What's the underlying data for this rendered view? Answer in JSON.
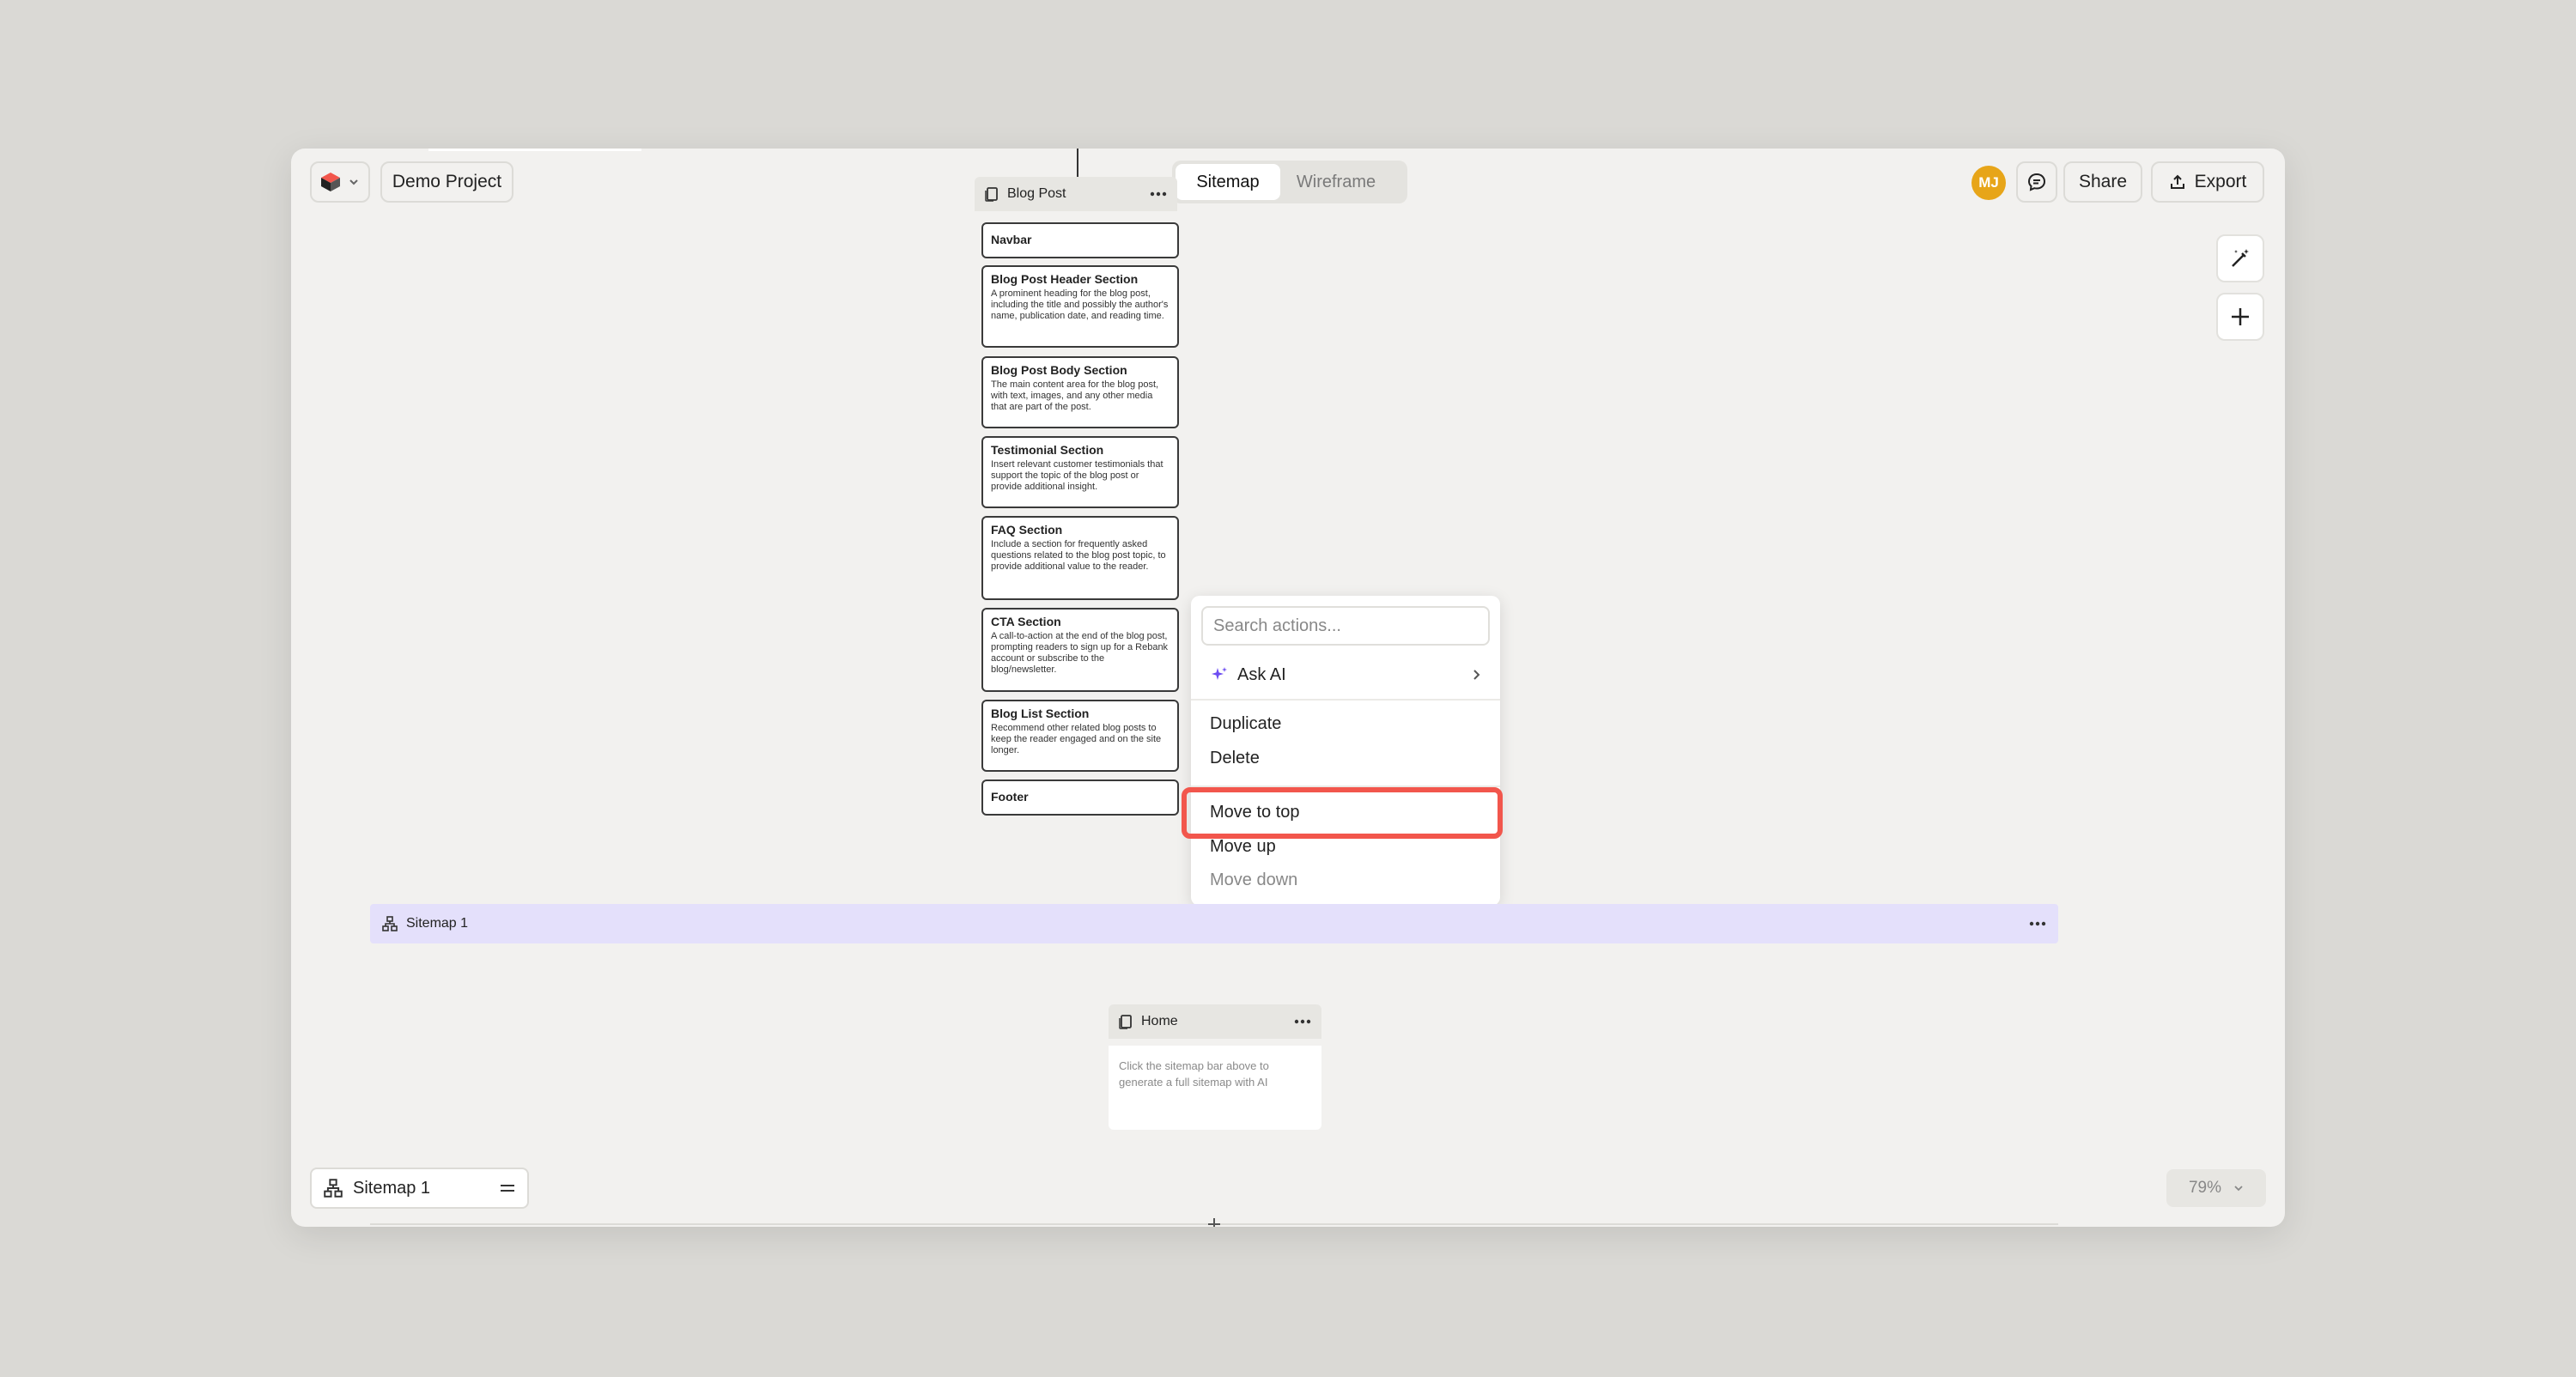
{
  "header": {
    "project_name": "Demo Project",
    "mode_tabs": [
      {
        "label": "Sitemap",
        "active": true
      },
      {
        "label": "Wireframe",
        "active": false
      }
    ],
    "avatar_initials": "MJ",
    "share_label": "Share",
    "export_label": "Export"
  },
  "page_card": {
    "title": "Blog Post",
    "sections": [
      {
        "title": "Navbar",
        "desc": ""
      },
      {
        "title": "Blog Post Header Section",
        "desc": "A prominent heading for the blog post, including the title and possibly the author's name, publication date, and reading time."
      },
      {
        "title": "Blog Post Body Section",
        "desc": "The main content area for the blog post, with text, images, and any other media that are part of the post."
      },
      {
        "title": "Testimonial Section",
        "desc": "Insert relevant customer testimonials that support the topic of the blog post or provide additional insight."
      },
      {
        "title": "FAQ Section",
        "desc": "Include a section for frequently asked questions related to the blog post topic, to provide additional value to the reader."
      },
      {
        "title": "CTA Section",
        "desc": "A call-to-action at the end of the blog post, prompting readers to sign up for a Rebank account or subscribe to the blog/newsletter."
      },
      {
        "title": "Blog List Section",
        "desc": "Recommend other related blog posts to keep the reader engaged and on the site longer."
      },
      {
        "title": "Footer",
        "desc": ""
      }
    ]
  },
  "context_menu": {
    "search_placeholder": "Search actions...",
    "ask_ai_label": "Ask AI",
    "duplicate_label": "Duplicate",
    "delete_label": "Delete",
    "move_to_top_label": "Move to top",
    "move_up_label": "Move up",
    "move_down_label": "Move down"
  },
  "sitemap_bar": {
    "title": "Sitemap 1"
  },
  "home_card": {
    "title": "Home",
    "placeholder_text": "Click the sitemap bar above to generate a full sitemap with AI"
  },
  "bottom_bar": {
    "sitemap_label": "Sitemap 1",
    "zoom_level": "79%"
  },
  "colors": {
    "accent_highlight": "#f2564c",
    "sitemap_bar_bg": "#e4e0fb",
    "avatar_bg": "#e7a519",
    "ai_sparkle": "#6d4df2"
  }
}
